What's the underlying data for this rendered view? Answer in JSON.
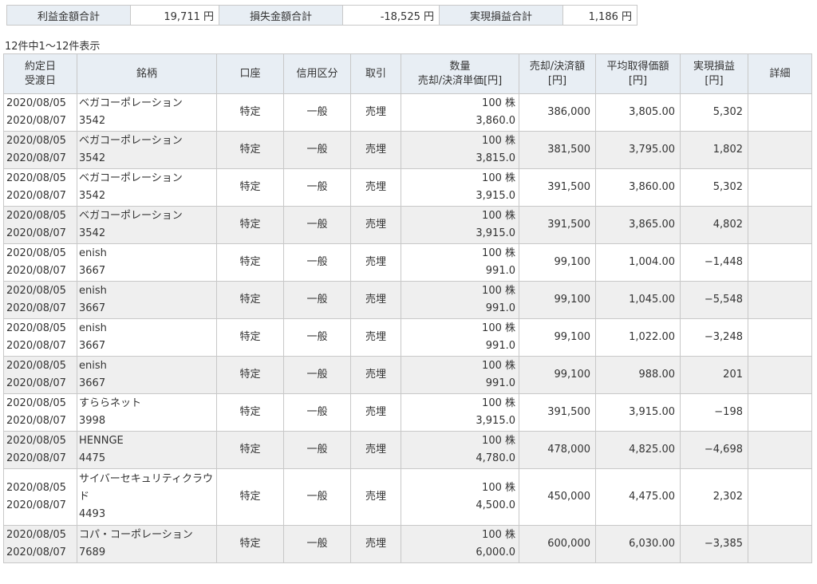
{
  "summary": {
    "profit_label": "利益金額合計",
    "profit_value": "19,711 円",
    "loss_label": "損失金額合計",
    "loss_value": "-18,525 円",
    "realized_label": "実現損益合計",
    "realized_value": "1,186 円"
  },
  "count_text": "12件中1～12件表示",
  "headers": {
    "date_1": "約定日",
    "date_2": "受渡日",
    "name": "銘柄",
    "account": "口座",
    "credit": "信用区分",
    "trade": "取引",
    "qty_1": "数量",
    "qty_2": "売却/決済単価[円]",
    "amount_1": "売却/決済額",
    "amount_2": "[円]",
    "avg_1": "平均取得価額",
    "avg_2": "[円]",
    "pl_1": "実現損益",
    "pl_2": "[円]",
    "detail": "詳細"
  },
  "rows": [
    {
      "trade_date": "2020/08/05",
      "settle_date": "2020/08/07",
      "name": "ベガコーポレーション",
      "code": "3542",
      "account": "特定",
      "credit": "一般",
      "trade": "売埋",
      "qty": "100 株",
      "price": "3,860.0",
      "amount": "386,000",
      "avg": "3,805.00",
      "pl": "5,302"
    },
    {
      "trade_date": "2020/08/05",
      "settle_date": "2020/08/07",
      "name": "ベガコーポレーション",
      "code": "3542",
      "account": "特定",
      "credit": "一般",
      "trade": "売埋",
      "qty": "100 株",
      "price": "3,815.0",
      "amount": "381,500",
      "avg": "3,795.00",
      "pl": "1,802"
    },
    {
      "trade_date": "2020/08/05",
      "settle_date": "2020/08/07",
      "name": "ベガコーポレーション",
      "code": "3542",
      "account": "特定",
      "credit": "一般",
      "trade": "売埋",
      "qty": "100 株",
      "price": "3,915.0",
      "amount": "391,500",
      "avg": "3,860.00",
      "pl": "5,302"
    },
    {
      "trade_date": "2020/08/05",
      "settle_date": "2020/08/07",
      "name": "ベガコーポレーション",
      "code": "3542",
      "account": "特定",
      "credit": "一般",
      "trade": "売埋",
      "qty": "100 株",
      "price": "3,915.0",
      "amount": "391,500",
      "avg": "3,865.00",
      "pl": "4,802"
    },
    {
      "trade_date": "2020/08/05",
      "settle_date": "2020/08/07",
      "name": "enish",
      "code": "3667",
      "account": "特定",
      "credit": "一般",
      "trade": "売埋",
      "qty": "100 株",
      "price": "991.0",
      "amount": "99,100",
      "avg": "1,004.00",
      "pl": "−1,448"
    },
    {
      "trade_date": "2020/08/05",
      "settle_date": "2020/08/07",
      "name": "enish",
      "code": "3667",
      "account": "特定",
      "credit": "一般",
      "trade": "売埋",
      "qty": "100 株",
      "price": "991.0",
      "amount": "99,100",
      "avg": "1,045.00",
      "pl": "−5,548"
    },
    {
      "trade_date": "2020/08/05",
      "settle_date": "2020/08/07",
      "name": "enish",
      "code": "3667",
      "account": "特定",
      "credit": "一般",
      "trade": "売埋",
      "qty": "100 株",
      "price": "991.0",
      "amount": "99,100",
      "avg": "1,022.00",
      "pl": "−3,248"
    },
    {
      "trade_date": "2020/08/05",
      "settle_date": "2020/08/07",
      "name": "enish",
      "code": "3667",
      "account": "特定",
      "credit": "一般",
      "trade": "売埋",
      "qty": "100 株",
      "price": "991.0",
      "amount": "99,100",
      "avg": "988.00",
      "pl": "201"
    },
    {
      "trade_date": "2020/08/05",
      "settle_date": "2020/08/07",
      "name": "すららネット",
      "code": "3998",
      "account": "特定",
      "credit": "一般",
      "trade": "売埋",
      "qty": "100 株",
      "price": "3,915.0",
      "amount": "391,500",
      "avg": "3,915.00",
      "pl": "−198"
    },
    {
      "trade_date": "2020/08/05",
      "settle_date": "2020/08/07",
      "name": "HENNGE",
      "code": "4475",
      "account": "特定",
      "credit": "一般",
      "trade": "売埋",
      "qty": "100 株",
      "price": "4,780.0",
      "amount": "478,000",
      "avg": "4,825.00",
      "pl": "−4,698"
    },
    {
      "trade_date": "2020/08/05",
      "settle_date": "2020/08/07",
      "name": "サイバーセキュリティクラウド",
      "code": "4493",
      "account": "特定",
      "credit": "一般",
      "trade": "売埋",
      "qty": "100 株",
      "price": "4,500.0",
      "amount": "450,000",
      "avg": "4,475.00",
      "pl": "2,302"
    },
    {
      "trade_date": "2020/08/05",
      "settle_date": "2020/08/07",
      "name": "コパ・コーポレーション",
      "code": "7689",
      "account": "特定",
      "credit": "一般",
      "trade": "売埋",
      "qty": "100 株",
      "price": "6,000.0",
      "amount": "600,000",
      "avg": "6,030.00",
      "pl": "−3,385"
    }
  ]
}
